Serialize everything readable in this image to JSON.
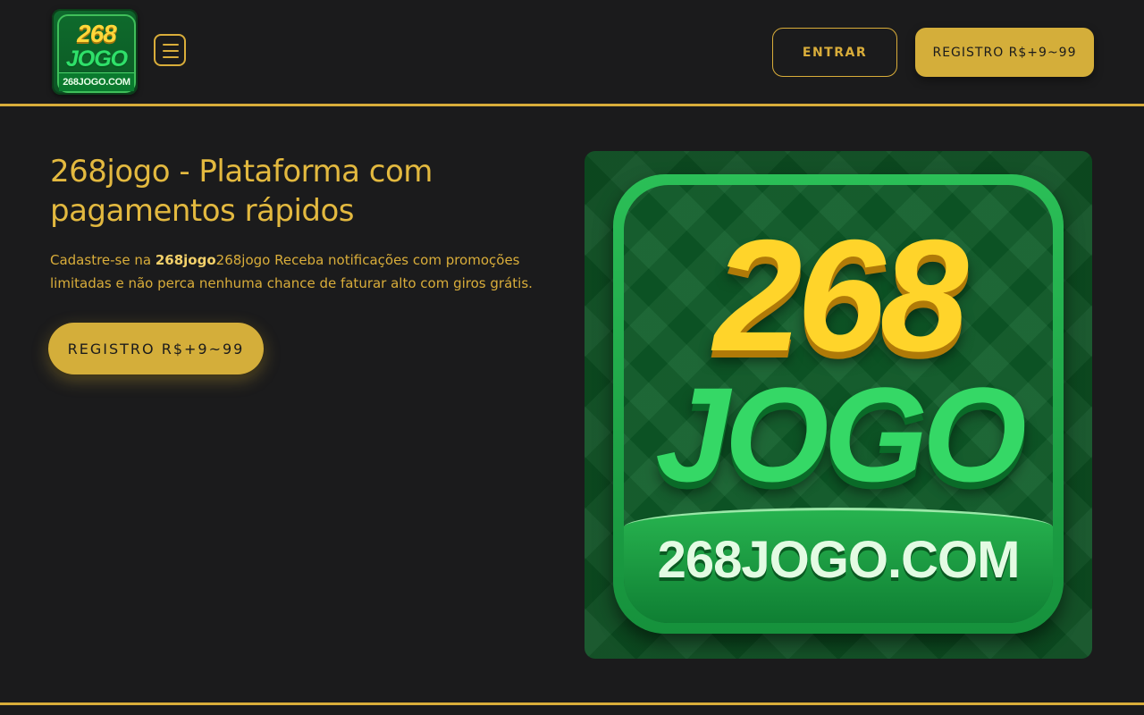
{
  "header": {
    "logo": {
      "number": "268",
      "word": "JOGO",
      "domain": "268JOGO.COM"
    },
    "login_label": "ENTRAR",
    "register_label": "REGISTRO R$+9~99"
  },
  "hero": {
    "title": "268jogo - Plataforma com pagamentos rápidos",
    "text_prefix": "Cadastre-se na ",
    "text_brand": "268jogo",
    "text_suffix": "268jogo Receba notificações com promoções limitadas e não perca nenhuma chance de faturar alto com giros grátis.",
    "register_label": "REGISTRO R$+9~99",
    "image": {
      "number": "268",
      "word": "JOGO",
      "domain": "268JOGO.COM"
    }
  },
  "colors": {
    "background": "#1b1b1c",
    "accent": "#d9ad3a",
    "button": "#d4ae3a",
    "logo_green": "#0e5c28",
    "logo_yellow": "#ffd42a"
  },
  "icons": {
    "menu": "hamburger-icon"
  }
}
